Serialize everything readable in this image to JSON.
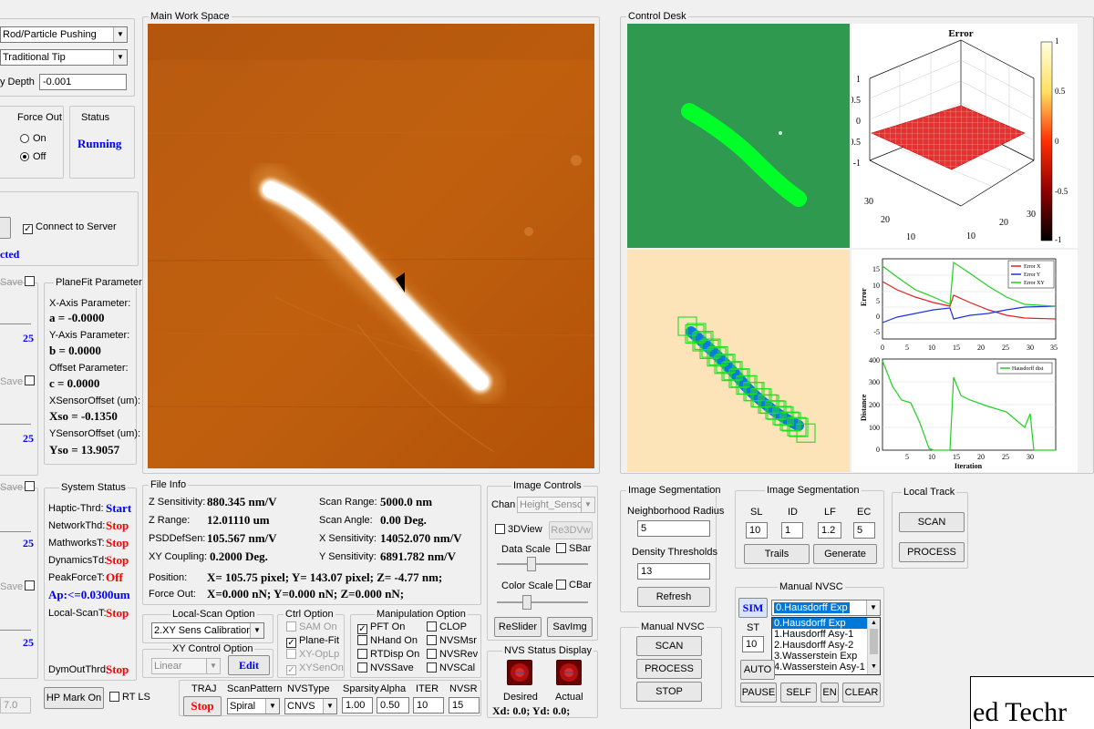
{
  "left_panel": {
    "mode_combo": "Rod/Particle Pushing",
    "tip_combo": "Traditional Tip",
    "depth_label": "y Depth",
    "depth_value": "-0.001",
    "force_out_title": "Force Out",
    "force_on": "On",
    "force_off": "Off",
    "status_title": "Status",
    "status_value": "Running",
    "connect_label": "Connect to Server",
    "connected_text": "cted",
    "save_labels": [
      "Save",
      "Save",
      "Save",
      "Save"
    ],
    "slider_values": [
      "25",
      "25",
      "25",
      "25"
    ],
    "plane_fit": {
      "title": "PlaneFit Parameter",
      "x_axis_label": "X-Axis Parameter:",
      "a_value": "a = -0.0000",
      "y_axis_label": "Y-Axis Parameter:",
      "b_value": "b = 0.0000",
      "offset_label": "Offset Parameter:",
      "c_value": "c = 0.0000",
      "xso_label": "XSensorOffset (um):",
      "xso_value": "Xso = -0.1350",
      "yso_label": "YSensorOffset (um):",
      "yso_value": "Yso = 13.9057"
    },
    "system_status": {
      "title": "System Status",
      "rows": [
        {
          "label": "Haptic-Thrd:",
          "value": "Start",
          "color": "blue"
        },
        {
          "label": "NetworkThd:",
          "value": "Stop",
          "color": "red"
        },
        {
          "label": "MathworksT:",
          "value": "Stop",
          "color": "red"
        },
        {
          "label": "DynamicsTd:",
          "value": "Stop",
          "color": "red"
        },
        {
          "label": "PeakForceT:",
          "value": "Off",
          "color": "red"
        }
      ],
      "ap_value": "Ap:<=0.0300um",
      "local_scan_label": "Local-ScanT:",
      "local_scan_value": "Stop",
      "dymout_label": "DymOutThrd:",
      "dymout_value": "Stop"
    },
    "bottom_value": "7.0",
    "hp_mark": "HP Mark On",
    "rt_ls": "RT LS"
  },
  "main_workspace": {
    "title": "Main Work Space"
  },
  "control_desk": {
    "title": "Control Desk",
    "error3d": {
      "title": "Error",
      "colorbar_ticks": [
        "1",
        "0.5",
        "0",
        "-0.5",
        "-1"
      ],
      "z_ticks": [
        "1",
        "0.5",
        "0",
        "-0.5",
        "-1"
      ],
      "x_ticks": [
        "30",
        "20",
        "10"
      ],
      "y_ticks": [
        "10",
        "20",
        "30"
      ]
    },
    "error_plot": {
      "ylabel": "Error",
      "yticks": [
        "15",
        "10",
        "5",
        "0",
        "-5"
      ],
      "xticks": [
        "0",
        "5",
        "10",
        "15",
        "20",
        "25",
        "30",
        "35"
      ],
      "legend": [
        "Error X",
        "Error Y",
        "Error XY"
      ]
    },
    "distance_plot": {
      "ylabel": "Distance",
      "xlabel": "Iteration",
      "yticks": [
        "400",
        "300",
        "200",
        "100",
        "0"
      ],
      "xticks": [
        "5",
        "10",
        "15",
        "20",
        "25",
        "30"
      ],
      "legend": [
        "Hausdorff dist"
      ]
    }
  },
  "file_info": {
    "title": "File Info",
    "z_sens_label": "Z Sensitivity:",
    "z_sens_value": "880.345 nm/V",
    "z_range_label": "Z Range:",
    "z_range_value": "12.01110 um",
    "psd_label": "PSDDefSen:",
    "psd_value": "105.567 nm/V",
    "xy_coupling_label": "XY Coupling:",
    "xy_coupling_value": "0.2000 Deg.",
    "scan_range_label": "Scan Range:",
    "scan_range_value": "5000.0 nm",
    "scan_angle_label": "Scan Angle:",
    "scan_angle_value": "0.00 Deg.",
    "x_sens_label": "X Sensitivity:",
    "x_sens_value": "14052.070 nm/V",
    "y_sens_label": "Y Sensitivity:",
    "y_sens_value": "6891.782 nm/V",
    "position_label": "Position:",
    "position_value": "X= 105.75 pixel; Y= 143.07 pixel; Z= -4.77 nm;",
    "force_label": "Force Out:",
    "force_value": "X=0.000 nN; Y=0.000 nN; Z=0.000 nN;"
  },
  "image_controls": {
    "title": "Image Controls",
    "chan_label": "Chan",
    "chan_value": "Height_Sensor",
    "view3d": "3DView",
    "re3dvw": "Re3DVw",
    "data_scale": "Data Scale",
    "sbar": "SBar",
    "color_scale": "Color Scale",
    "cbar": "CBar",
    "reslider": "ReSlider",
    "savimg": "SavImg"
  },
  "local_scan": {
    "title": "Local-Scan Option",
    "value": "2.XY Sens Calibration"
  },
  "xy_control": {
    "title": "XY Control Option",
    "value": "Linear",
    "edit": "Edit"
  },
  "ctrl_option": {
    "title": "Ctrl Option",
    "items": [
      {
        "label": "SAM On",
        "checked": false,
        "disabled": true
      },
      {
        "label": "Plane-Fit",
        "checked": true,
        "disabled": false
      },
      {
        "label": "XY-OpLp",
        "checked": false,
        "disabled": true
      },
      {
        "label": "XYSenOn",
        "checked": true,
        "disabled": true
      }
    ]
  },
  "manipulation": {
    "title": "Manipulation Option",
    "items": [
      {
        "label": "PFT On",
        "checked": true
      },
      {
        "label": "CLOP",
        "checked": false
      },
      {
        "label": "NHand On",
        "checked": false
      },
      {
        "label": "NVSMsr",
        "checked": false
      },
      {
        "label": "RTDisp On",
        "checked": false
      },
      {
        "label": "NVSRev",
        "checked": false
      },
      {
        "label": "NVSSave",
        "checked": false
      },
      {
        "label": "NVSCal",
        "checked": false
      }
    ]
  },
  "traj_bar": {
    "traj_label": "TRAJ",
    "stop_button": "Stop",
    "scan_pattern_label": "ScanPattern",
    "scan_pattern_value": "Spiral",
    "nvstype_label": "NVSType",
    "nvstype_value": "CNVS",
    "sparsity_label": "Sparsity",
    "sparsity_value": "1.00",
    "alpha_label": "Alpha",
    "alpha_value": "0.50",
    "iter_label": "ITER",
    "iter_value": "10",
    "nvsr_label": "NVSR",
    "nvsr_value": "15"
  },
  "nvs_status": {
    "title": "NVS Status Display",
    "desired": "Desired",
    "actual": "Actual",
    "xd_yd": "Xd: 0.0; Yd: 0.0;"
  },
  "image_seg1": {
    "title": "Image Segmentation",
    "neighborhood_label": "Neighborhood Radius",
    "neighborhood_value": "5",
    "density_label": "Density Thresholds",
    "density_value": "13",
    "refresh": "Refresh"
  },
  "image_seg2": {
    "title": "Image Segmentation",
    "headers": [
      "SL",
      "ID",
      "LF",
      "EC"
    ],
    "values": [
      "10",
      "1",
      "1.2",
      "5"
    ],
    "trails": "Trails",
    "generate": "Generate"
  },
  "local_track": {
    "title": "Local Track",
    "scan": "SCAN",
    "process": "PROCESS"
  },
  "manual_nvsc1": {
    "title": "Manual NVSC",
    "scan": "SCAN",
    "process": "PROCESS",
    "stop": "STOP"
  },
  "manual_nvsc2": {
    "title": "Manual NVSC",
    "sim": "SIM",
    "st": "ST",
    "st_value": "10",
    "auto": "AUTO",
    "pause": "PAUSE",
    "self": "SELF",
    "en": "EN",
    "clear": "CLEAR",
    "selected": "0.Hausdorff Exp",
    "options": [
      "0.Hausdorff Exp",
      "1.Hausdorff Asy-1",
      "2.Hausdorff Asy-2",
      "3.Wasserstein Exp",
      "4.Wasserstein Asy-1"
    ]
  },
  "logo_text": "ed Techr"
}
